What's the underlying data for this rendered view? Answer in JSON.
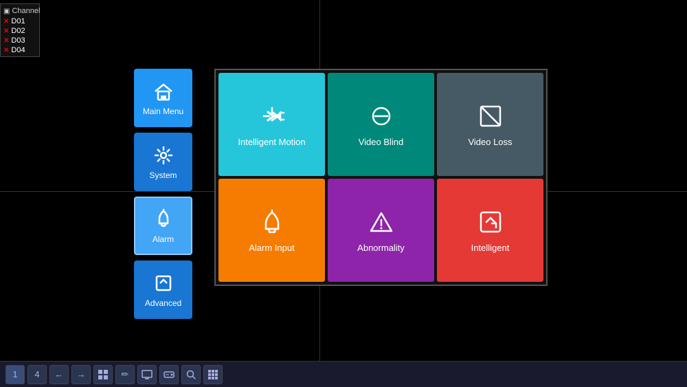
{
  "sidebar": {
    "title": "Channel",
    "channels": [
      {
        "id": "D01",
        "status": "error"
      },
      {
        "id": "D02",
        "status": "error"
      },
      {
        "id": "D03",
        "status": "error"
      },
      {
        "id": "D04",
        "status": "error"
      }
    ]
  },
  "sideMenu": {
    "items": [
      {
        "id": "main-menu",
        "label": "Main Menu",
        "color": "tile-blue"
      },
      {
        "id": "system",
        "label": "System",
        "color": "tile-blue2"
      },
      {
        "id": "alarm",
        "label": "Alarm",
        "color": "tile-blue-light"
      },
      {
        "id": "advanced",
        "label": "Advanced",
        "color": "tile-blue2"
      }
    ]
  },
  "gridTiles": [
    {
      "id": "intelligent-motion",
      "label": "Intelligent Motion",
      "color": "tile-cyan"
    },
    {
      "id": "video-blind",
      "label": "Video Blind",
      "color": "tile-teal"
    },
    {
      "id": "video-loss",
      "label": "Video Loss",
      "color": "tile-steel"
    },
    {
      "id": "alarm-input",
      "label": "Alarm Input",
      "color": "tile-orange"
    },
    {
      "id": "abnormality",
      "label": "Abnormality",
      "color": "tile-purple"
    },
    {
      "id": "intelligent",
      "label": "Intelligent",
      "color": "tile-red"
    }
  ],
  "toolbar": {
    "buttons": [
      "1",
      "4",
      "←",
      "→",
      "▣",
      "✎",
      "⊞",
      "☖",
      "⊡",
      "⊟",
      "▦"
    ]
  }
}
